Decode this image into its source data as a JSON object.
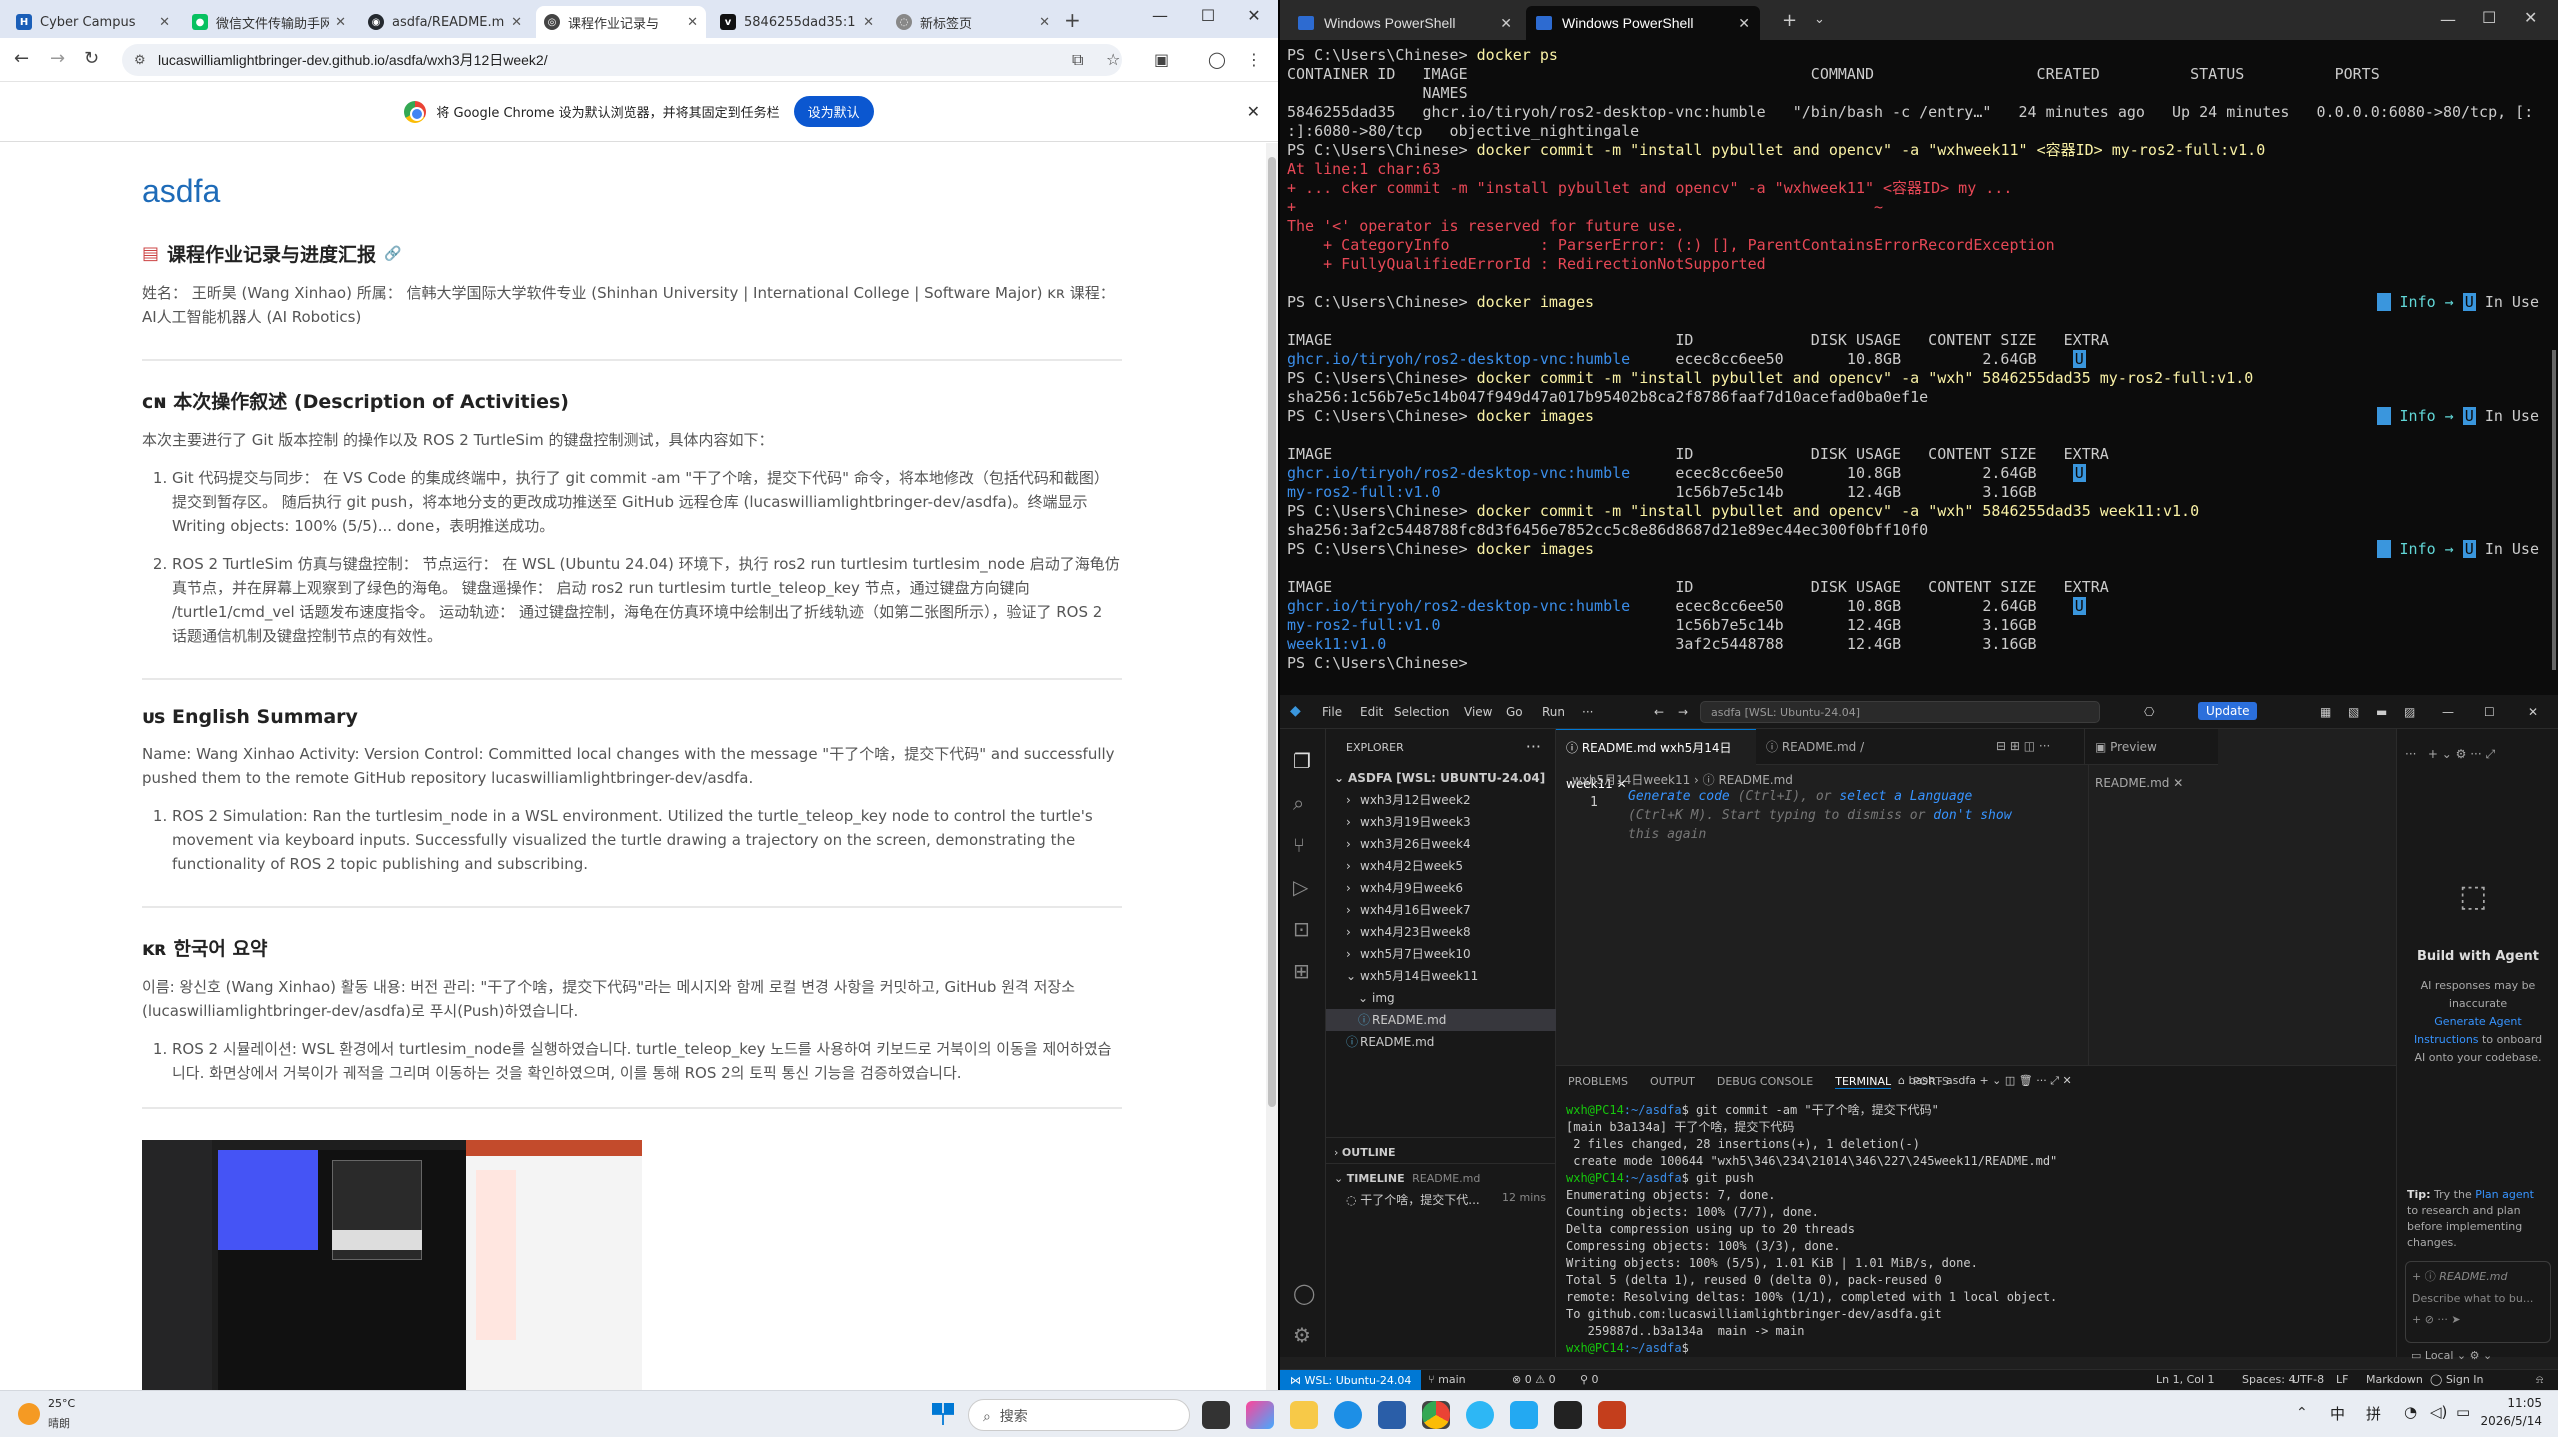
{
  "chrome": {
    "tabs": [
      {
        "title": "Cyber Campus",
        "color": "#1b5fb8",
        "icon": "cyber-campus-icon"
      },
      {
        "title": "微信文件传输助手网",
        "color": "#07c160",
        "icon": "wechat-icon"
      },
      {
        "title": "asdfa/README.md",
        "color": "#24292f",
        "icon": "github-icon"
      },
      {
        "title": "课程作业记录与",
        "color": "#444444",
        "icon": "github-pages-icon"
      },
      {
        "title": "5846255dad35:1",
        "color": "#111111",
        "icon": "vnc-icon"
      },
      {
        "title": "新标签页",
        "color": "#555555",
        "icon": "new-tab-icon"
      }
    ],
    "url": "lucaswilliamlightbringer-dev.github.io/asdfa/wxh3月12日week2/",
    "infobar_text": "将 Google Chrome 设为默认浏览器，并将其固定到任务栏",
    "infobar_button": "设为默认"
  },
  "page": {
    "site_title": "asdfa",
    "main_heading": "课程作业记录与进度汇报",
    "intro": "姓名： 王昕昊 (Wang Xinhao) 所属： 信韩大学国际大学软件专业 (Shinhan University | International College | Software Major) ᴋʀ 课程： AI人工智能机器人 (AI Robotics)",
    "cn_heading": "ᴄɴ 本次操作叙述 (Description of Activities)",
    "cn_intro": "本次主要进行了 Git 版本控制 的操作以及 ROS 2 TurtleSim 的键盘控制测试，具体内容如下：",
    "cn_items": [
      "Git 代码提交与同步： 在 VS Code 的集成终端中，执行了 git commit -am \"干了个啥，提交下代码\" 命令，将本地修改（包括代码和截图）提交到暂存区。 随后执行 git push，将本地分支的更改成功推送至 GitHub 远程仓库 (lucaswilliamlightbringer-dev/asdfa)。终端显示 Writing objects: 100% (5/5)... done，表明推送成功。",
      "ROS 2 TurtleSim 仿真与键盘控制： 节点运行： 在 WSL (Ubuntu 24.04) 环境下，执行 ros2 run turtlesim turtlesim_node 启动了海龟仿真节点，并在屏幕上观察到了绿色的海龟。 键盘遥操作： 启动 ros2 run turtlesim turtle_teleop_key 节点，通过键盘方向键向 /turtle1/cmd_vel 话题发布速度指令。 运动轨迹： 通过键盘控制，海龟在仿真环境中绘制出了折线轨迹（如第二张图所示），验证了 ROS 2 话题通信机制及键盘控制节点的有效性。"
    ],
    "us_heading": "ᴜs English Summary",
    "us_intro": "Name: Wang Xinhao Activity: Version Control: Committed local changes with the message \"干了个啥，提交下代码\" and successfully pushed them to the remote GitHub repository lucaswilliamlightbringer-dev/asdfa.",
    "us_items": [
      "ROS 2 Simulation: Ran the turtlesim_node in a WSL environment. Utilized the turtle_teleop_key node to control the turtle's movement via keyboard inputs. Successfully visualized the turtle drawing a trajectory on the screen, demonstrating the functionality of ROS 2 topic publishing and subscribing."
    ],
    "kr_heading": "ᴋʀ 한국어 요약",
    "kr_intro": "이름: 왕신호 (Wang Xinhao) 활동 내용: 버전 관리: \"干了个啥，提交下代码\"라는 메시지와 함께 로컬 변경 사항을 커밋하고, GitHub 원격 저장소(lucaswilliamlightbringer-dev/asdfa)로 푸시(Push)하였습니다.",
    "kr_items": [
      "ROS 2 시뮬레이션: WSL 환경에서 turtlesim_node를 실행하였습니다. turtle_teleop_key 노드를 사용하여 키보드로 거북이의 이동을 제어하였습니다. 화면상에서 거북이가 궤적을 그리며 이동하는 것을 확인하였으며, 이를 통해 ROS 2의 토픽 통신 기능을 검증하였습니다."
    ]
  },
  "terminal": {
    "tabs": [
      "Windows PowerShell",
      "Windows PowerShell"
    ],
    "lines": [
      {
        "t": "PS C:\\Users\\Chinese> ",
        "cmd": "docker ps"
      },
      {
        "t": "CONTAINER ID   IMAGE                                      COMMAND                  CREATED          STATUS          PORTS"
      },
      {
        "t": "               NAMES"
      },
      {
        "t": "5846255dad35   ghcr.io/tiryoh/ros2-desktop-vnc:humble   \"/bin/bash -c /entry…\"   24 minutes ago   Up 24 minutes   0.0.0.0:6080->80/tcp, [:"
      },
      {
        "t": ":]:6080->80/tcp   objective_nightingale"
      },
      {
        "t": "PS C:\\Users\\Chinese> ",
        "cmd": "docker commit -m \"install pybullet and opencv\" -a \"wxhweek11\" <容器ID> my-ros2-full:v1.0"
      },
      {
        "t": "At line:1 char:63",
        "cls": "c-r"
      },
      {
        "t": "+ ... cker commit -m \"install pybullet and opencv\" -a \"wxhweek11\" <容器ID> my ...",
        "cls": "c-r"
      },
      {
        "t": "+                                                                ~",
        "cls": "c-r"
      },
      {
        "t": "The '<' operator is reserved for future use.",
        "cls": "c-r"
      },
      {
        "t": "    + CategoryInfo          : ParserError: (:) [], ParentContainsErrorRecordException",
        "cls": "c-r"
      },
      {
        "t": "    + FullyQualifiedErrorId : RedirectionNotSupported",
        "cls": "c-r"
      },
      {
        "t": ""
      },
      {
        "t": "PS C:\\Users\\Chinese> ",
        "cmd": "docker images",
        "info": true
      },
      {
        "t": ""
      },
      {
        "t": "IMAGE                                      ID             DISK USAGE   CONTENT SIZE   EXTRA"
      },
      {
        "t": "ghcr.io/tiryoh/ros2-desktop-vnc:humble",
        "cls": "c-b",
        "rest": "     ecec8cc6ee50       10.8GB         2.64GB    ",
        "u": true
      },
      {
        "t": "PS C:\\Users\\Chinese> ",
        "cmd": "docker commit -m \"install pybullet and opencv\" -a \"wxh\" 5846255dad35 my-ros2-full:v1.0"
      },
      {
        "t": "sha256:1c56b7e5c14b047f949d47a017b95402b8ca2f8786faaf7d10acefad0ba0ef1e"
      },
      {
        "t": "PS C:\\Users\\Chinese> ",
        "cmd": "docker images",
        "info": true
      },
      {
        "t": ""
      },
      {
        "t": "IMAGE                                      ID             DISK USAGE   CONTENT SIZE   EXTRA"
      },
      {
        "t": "ghcr.io/tiryoh/ros2-desktop-vnc:humble",
        "cls": "c-b",
        "rest": "     ecec8cc6ee50       10.8GB         2.64GB    ",
        "u": true
      },
      {
        "t": "my-ros2-full:v1.0",
        "cls": "c-b",
        "rest": "                          1c56b7e5c14b       12.4GB         3.16GB"
      },
      {
        "t": "PS C:\\Users\\Chinese> ",
        "cmd": "docker commit -m \"install pybullet and opencv\" -a \"wxh\" 5846255dad35 week11:v1.0"
      },
      {
        "t": "sha256:3af2c5448788fc8d3f6456e7852cc5c8e86d8687d21e89ec44ec300f0bff10f0"
      },
      {
        "t": "PS C:\\Users\\Chinese> ",
        "cmd": "docker images",
        "info": true
      },
      {
        "t": ""
      },
      {
        "t": "IMAGE                                      ID             DISK USAGE   CONTENT SIZE   EXTRA"
      },
      {
        "t": "ghcr.io/tiryoh/ros2-desktop-vnc:humble",
        "cls": "c-b",
        "rest": "     ecec8cc6ee50       10.8GB         2.64GB    ",
        "u": true
      },
      {
        "t": "my-ros2-full:v1.0",
        "cls": "c-b",
        "rest": "                          1c56b7e5c14b       12.4GB         3.16GB"
      },
      {
        "t": "week11:v1.0",
        "cls": "c-b",
        "rest": "                                3af2c5448788       12.4GB         3.16GB"
      },
      {
        "t": "PS C:\\Users\\Chinese> "
      }
    ],
    "info_label": "Info",
    "inuse_label": "In Use"
  },
  "vscode": {
    "menu": [
      "File",
      "Edit",
      "Selection",
      "View",
      "Go",
      "Run",
      "···"
    ],
    "search": "asdfa [WSL: Ubuntu-24.04]",
    "update": "Update",
    "explorer_title": "EXPLORER",
    "tree": [
      {
        "label": "ASDFA [WSL: UBUNTU-24.04]",
        "indent": 0,
        "mark": "⌄"
      },
      {
        "label": "wxh3月12日week2",
        "indent": 1,
        "mark": "›"
      },
      {
        "label": "wxh3月19日week3",
        "indent": 1,
        "mark": "›"
      },
      {
        "label": "wxh3月26日week4",
        "indent": 1,
        "mark": "›"
      },
      {
        "label": "wxh4月2日week5",
        "indent": 1,
        "mark": "›"
      },
      {
        "label": "wxh4月9日week6",
        "indent": 1,
        "mark": "›"
      },
      {
        "label": "wxh4月16日week7",
        "indent": 1,
        "mark": "›"
      },
      {
        "label": "wxh4月23日week8",
        "indent": 1,
        "mark": "›"
      },
      {
        "label": "wxh5月7日week10",
        "indent": 1,
        "mark": "›"
      },
      {
        "label": "wxh5月14日week11",
        "indent": 1,
        "mark": "⌄"
      },
      {
        "label": "img",
        "indent": 2,
        "mark": "⌄"
      },
      {
        "label": "README.md",
        "indent": 2,
        "mark": "ⓘ",
        "sel": true
      },
      {
        "label": "README.md",
        "indent": 1,
        "mark": "ⓘ"
      }
    ],
    "outline": "OUTLINE",
    "timeline": "TIMELINE",
    "timeline_file": "README.md",
    "timeline_entry": "干了个啥，提交下代...",
    "timeline_time": "12 mins",
    "tabs": [
      "README.md  wxh5月14日week11",
      "README.md  /",
      "Preview README.md"
    ],
    "crumb": "wxh5月14日week11 › ⓘ README.md",
    "line_no": "1",
    "hint_parts": [
      "Generate code",
      " (Ctrl+I), or ",
      "select a Language",
      " (Ctrl+K M). Start typing to dismiss or ",
      "don't show",
      " this again"
    ],
    "panel_tabs": [
      "PROBLEMS",
      "OUTPUT",
      "DEBUG CONSOLE",
      "TERMINAL",
      "PORTS"
    ],
    "panel_shell": "bash - asdfa",
    "panel_lines": [
      "wxh@PC14:~/asdfa$ git commit -am \"干了个啥，提交下代码\"",
      "[main b3a134a] 干了个啥，提交下代码",
      " 2 files changed, 28 insertions(+), 1 deletion(-)",
      " create mode 100644 \"wxh5\\346\\234\\21014\\346\\227\\245week11/README.md\"",
      "wxh@PC14:~/asdfa$ git push",
      "Enumerating objects: 7, done.",
      "Counting objects: 100% (7/7), done.",
      "Delta compression using up to 20 threads",
      "Compressing objects: 100% (3/3), done.",
      "Writing objects: 100% (5/5), 1.01 KiB | 1.01 MiB/s, done.",
      "Total 5 (delta 1), reused 0 (delta 0), pack-reused 0",
      "remote: Resolving deltas: 100% (1/1), completed with 1 local object.",
      "To github.com:lucaswilliamlightbringer-dev/asdfa.git",
      "   259887d..b3a134a  main -> main",
      "wxh@PC14:~/asdfa$ "
    ],
    "agent_title": "Build with Agent",
    "agent_text1": "AI responses may be inaccurate",
    "agent_link": "Generate Agent Instructions",
    "agent_text2": "to onboard AI onto your codebase.",
    "tip_label": "Tip:",
    "tip_text1": "Try the",
    "tip_link": "Plan agent",
    "tip_text2": "to research and plan before implementing changes.",
    "agent_file": "README.md",
    "agent_placeholder": "Describe what to bu...",
    "agent_local": "Local",
    "status": {
      "wsl": "WSL: Ubuntu-24.04",
      "branch": "main",
      "problems": "⊗ 0 ⚠ 0",
      "ports": "⚲ 0",
      "pos": "Ln 1, Col 1",
      "spaces": "Spaces: 4",
      "enc": "UTF-8",
      "eol": "LF",
      "lang": "Markdown",
      "signin": "Sign In"
    }
  },
  "taskbar": {
    "weather_temp": "25°C",
    "weather_text": "晴朗",
    "search": "搜索",
    "time": "11:05",
    "date": "2026/5/14",
    "ime1": "中",
    "ime2": "拼"
  }
}
